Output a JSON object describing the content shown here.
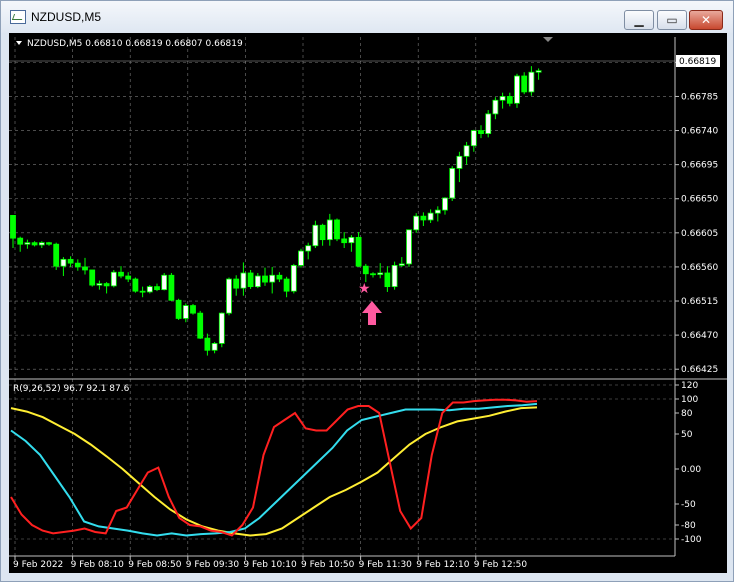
{
  "window": {
    "title": "NZDUSD,M5"
  },
  "chart": {
    "header": "NZDUSD,M5  0.66810 0.66819 0.66807 0.66819",
    "current_price": "0.66819",
    "price_ticks": [
      "0.66830",
      "0.66785",
      "0.66740",
      "0.66695",
      "0.66650",
      "0.66605",
      "0.66560",
      "0.66515",
      "0.66470",
      "0.66425"
    ],
    "indicator_header": "R(9,26,52) 96.7 92.1 87.6",
    "indicator_ticks": [
      "120",
      "100",
      "80",
      "50",
      "0.00",
      "-50",
      "-80",
      "-100"
    ],
    "time_labels": [
      "9 Feb 2022",
      "9 Feb 08:10",
      "9 Feb 08:50",
      "9 Feb 09:30",
      "9 Feb 10:10",
      "9 Feb 10:50",
      "9 Feb 11:30",
      "9 Feb 12:10",
      "9 Feb 12:50"
    ],
    "colors": {
      "bull": "#ffffff",
      "bear": "#00ff00",
      "grid": "#7a7a7a",
      "fast": "#ff2020",
      "mid": "#33ddee",
      "slow": "#ffee33",
      "signal_arrow": "#ff5aa0",
      "signal_star": "#ff5aa0"
    },
    "price_min": 0.6642,
    "price_max": 0.66845,
    "candles": [
      [
        0.66628,
        0.66628,
        0.66585,
        0.66598
      ],
      [
        0.66598,
        0.666,
        0.6658,
        0.6659
      ],
      [
        0.6659,
        0.66596,
        0.66584,
        0.66592
      ],
      [
        0.66592,
        0.66594,
        0.66587,
        0.66589
      ],
      [
        0.66589,
        0.66594,
        0.66585,
        0.66592
      ],
      [
        0.66592,
        0.66593,
        0.66588,
        0.6659
      ],
      [
        0.6659,
        0.66592,
        0.66556,
        0.66561
      ],
      [
        0.66561,
        0.66573,
        0.66548,
        0.6657
      ],
      [
        0.6657,
        0.66574,
        0.6656,
        0.66565
      ],
      [
        0.66565,
        0.6657,
        0.66555,
        0.6656
      ],
      [
        0.6656,
        0.66572,
        0.6655,
        0.66556
      ],
      [
        0.66556,
        0.66556,
        0.66534,
        0.66536
      ],
      [
        0.66536,
        0.66542,
        0.6653,
        0.66538
      ],
      [
        0.66538,
        0.6654,
        0.66525,
        0.66535
      ],
      [
        0.66535,
        0.66556,
        0.66533,
        0.66553
      ],
      [
        0.66553,
        0.66561,
        0.66545,
        0.66548
      ],
      [
        0.66548,
        0.66553,
        0.6654,
        0.66544
      ],
      [
        0.66544,
        0.66546,
        0.66526,
        0.66528
      ],
      [
        0.66528,
        0.66534,
        0.6652,
        0.66527
      ],
      [
        0.66527,
        0.66536,
        0.66525,
        0.66534
      ],
      [
        0.66534,
        0.66538,
        0.66528,
        0.6653
      ],
      [
        0.6653,
        0.66552,
        0.66529,
        0.66549
      ],
      [
        0.66549,
        0.66552,
        0.66515,
        0.66516
      ],
      [
        0.66516,
        0.66518,
        0.6649,
        0.66492
      ],
      [
        0.66492,
        0.66512,
        0.66487,
        0.66509
      ],
      [
        0.66509,
        0.66511,
        0.66497,
        0.66499
      ],
      [
        0.66499,
        0.66502,
        0.66465,
        0.66466
      ],
      [
        0.66466,
        0.66472,
        0.66443,
        0.6645
      ],
      [
        0.6645,
        0.66461,
        0.66446,
        0.66459
      ],
      [
        0.66459,
        0.665,
        0.66454,
        0.66499
      ],
      [
        0.66499,
        0.66546,
        0.66496,
        0.66544
      ],
      [
        0.66544,
        0.66549,
        0.66522,
        0.66532
      ],
      [
        0.66532,
        0.66566,
        0.66522,
        0.66552
      ],
      [
        0.66552,
        0.66556,
        0.66531,
        0.66534
      ],
      [
        0.66534,
        0.66552,
        0.66532,
        0.66548
      ],
      [
        0.66548,
        0.66559,
        0.66535,
        0.6654
      ],
      [
        0.6654,
        0.6656,
        0.66525,
        0.66549
      ],
      [
        0.66549,
        0.66553,
        0.6654,
        0.66544
      ],
      [
        0.66544,
        0.66547,
        0.6652,
        0.66528
      ],
      [
        0.66528,
        0.66564,
        0.66525,
        0.66562
      ],
      [
        0.66562,
        0.66584,
        0.66559,
        0.66581
      ],
      [
        0.66581,
        0.66592,
        0.6657,
        0.66588
      ],
      [
        0.66588,
        0.66621,
        0.66585,
        0.66615
      ],
      [
        0.66615,
        0.66617,
        0.66588,
        0.66596
      ],
      [
        0.66596,
        0.6663,
        0.66588,
        0.66622
      ],
      [
        0.66622,
        0.66624,
        0.66594,
        0.66597
      ],
      [
        0.66597,
        0.66606,
        0.66585,
        0.66592
      ],
      [
        0.66592,
        0.66602,
        0.6658,
        0.66599
      ],
      [
        0.66599,
        0.66606,
        0.6656,
        0.66561
      ],
      [
        0.66561,
        0.66564,
        0.6654,
        0.66551
      ],
      [
        0.66551,
        0.66553,
        0.66546,
        0.6655
      ],
      [
        0.6655,
        0.66565,
        0.66545,
        0.66552
      ],
      [
        0.66552,
        0.66561,
        0.66527,
        0.66534
      ],
      [
        0.66534,
        0.66567,
        0.6653,
        0.66562
      ],
      [
        0.66562,
        0.66573,
        0.6656,
        0.66564
      ],
      [
        0.66564,
        0.66608,
        0.6656,
        0.66609
      ],
      [
        0.66609,
        0.66631,
        0.66605,
        0.66627
      ],
      [
        0.66627,
        0.66632,
        0.66614,
        0.66622
      ],
      [
        0.66622,
        0.66636,
        0.66618,
        0.66631
      ],
      [
        0.66631,
        0.6664,
        0.6662,
        0.66635
      ],
      [
        0.66635,
        0.66652,
        0.66629,
        0.66651
      ],
      [
        0.66651,
        0.66693,
        0.66647,
        0.6669
      ],
      [
        0.6669,
        0.66712,
        0.66672,
        0.66706
      ],
      [
        0.66706,
        0.66725,
        0.66695,
        0.6672
      ],
      [
        0.6672,
        0.66741,
        0.66712,
        0.6674
      ],
      [
        0.6674,
        0.66747,
        0.6673,
        0.66736
      ],
      [
        0.66736,
        0.66767,
        0.66731,
        0.66762
      ],
      [
        0.66762,
        0.66784,
        0.66755,
        0.6678
      ],
      [
        0.6678,
        0.6679,
        0.66769,
        0.66785
      ],
      [
        0.66785,
        0.6679,
        0.66772,
        0.66776
      ],
      [
        0.66776,
        0.66815,
        0.6677,
        0.66812
      ],
      [
        0.66812,
        0.66817,
        0.66788,
        0.66791
      ],
      [
        0.66791,
        0.66825,
        0.66786,
        0.66817
      ],
      [
        0.66817,
        0.66822,
        0.66807,
        0.66819
      ]
    ],
    "fast_line": [
      [
        0,
        -40
      ],
      [
        1,
        -65
      ],
      [
        2,
        -80
      ],
      [
        3,
        -88
      ],
      [
        4,
        -92
      ],
      [
        5,
        -90
      ],
      [
        6,
        -88
      ],
      [
        7,
        -85
      ],
      [
        8,
        -90
      ],
      [
        9,
        -92
      ],
      [
        10,
        -60
      ],
      [
        11,
        -55
      ],
      [
        12,
        -30
      ],
      [
        13,
        -5
      ],
      [
        14,
        2
      ],
      [
        15,
        -40
      ],
      [
        16,
        -70
      ],
      [
        17,
        -80
      ],
      [
        18,
        -82
      ],
      [
        19,
        -88
      ],
      [
        20,
        -90
      ],
      [
        21,
        -95
      ],
      [
        22,
        -80
      ],
      [
        23,
        -55
      ],
      [
        24,
        20
      ],
      [
        25,
        60
      ],
      [
        26,
        70
      ],
      [
        27,
        80
      ],
      [
        28,
        58
      ],
      [
        29,
        55
      ],
      [
        30,
        55
      ],
      [
        31,
        70
      ],
      [
        32,
        85
      ],
      [
        33,
        90
      ],
      [
        34,
        90
      ],
      [
        35,
        80
      ],
      [
        36,
        10
      ],
      [
        37,
        -60
      ],
      [
        38,
        -85
      ],
      [
        39,
        -70
      ],
      [
        40,
        20
      ],
      [
        41,
        80
      ],
      [
        42,
        95
      ],
      [
        43,
        95
      ],
      [
        44,
        97
      ],
      [
        45,
        98
      ],
      [
        46,
        99
      ],
      [
        47,
        99
      ],
      [
        48,
        98
      ],
      [
        49,
        96
      ],
      [
        50,
        97
      ]
    ],
    "mid_line": [
      [
        0,
        55
      ],
      [
        1,
        40
      ],
      [
        2,
        20
      ],
      [
        3,
        -10
      ],
      [
        4,
        -40
      ],
      [
        5,
        -75
      ],
      [
        6,
        -82
      ],
      [
        7,
        -85
      ],
      [
        8,
        -88
      ],
      [
        9,
        -92
      ],
      [
        10,
        -95
      ],
      [
        11,
        -92
      ],
      [
        12,
        -95
      ],
      [
        13,
        -93
      ],
      [
        14,
        -92
      ],
      [
        15,
        -90
      ],
      [
        16,
        -85
      ],
      [
        17,
        -70
      ],
      [
        18,
        -50
      ],
      [
        19,
        -30
      ],
      [
        20,
        -10
      ],
      [
        21,
        10
      ],
      [
        22,
        30
      ],
      [
        23,
        55
      ],
      [
        24,
        70
      ],
      [
        25,
        75
      ],
      [
        26,
        80
      ],
      [
        27,
        85
      ],
      [
        28,
        85
      ],
      [
        29,
        85
      ],
      [
        30,
        84
      ],
      [
        31,
        86
      ],
      [
        32,
        86
      ],
      [
        33,
        88
      ],
      [
        34,
        90
      ],
      [
        35,
        91
      ],
      [
        36,
        93
      ]
    ],
    "slow_line": [
      [
        0,
        87
      ],
      [
        1,
        82
      ],
      [
        2,
        74
      ],
      [
        3,
        62
      ],
      [
        4,
        50
      ],
      [
        5,
        35
      ],
      [
        6,
        18
      ],
      [
        7,
        0
      ],
      [
        8,
        -20
      ],
      [
        9,
        -40
      ],
      [
        10,
        -58
      ],
      [
        11,
        -72
      ],
      [
        12,
        -82
      ],
      [
        13,
        -88
      ],
      [
        14,
        -92
      ],
      [
        15,
        -95
      ],
      [
        16,
        -93
      ],
      [
        17,
        -85
      ],
      [
        18,
        -70
      ],
      [
        19,
        -55
      ],
      [
        20,
        -40
      ],
      [
        21,
        -30
      ],
      [
        22,
        -18
      ],
      [
        23,
        -5
      ],
      [
        24,
        15
      ],
      [
        25,
        35
      ],
      [
        26,
        50
      ],
      [
        27,
        60
      ],
      [
        28,
        68
      ],
      [
        29,
        72
      ],
      [
        30,
        76
      ],
      [
        31,
        82
      ],
      [
        32,
        87
      ],
      [
        33,
        88
      ]
    ]
  }
}
